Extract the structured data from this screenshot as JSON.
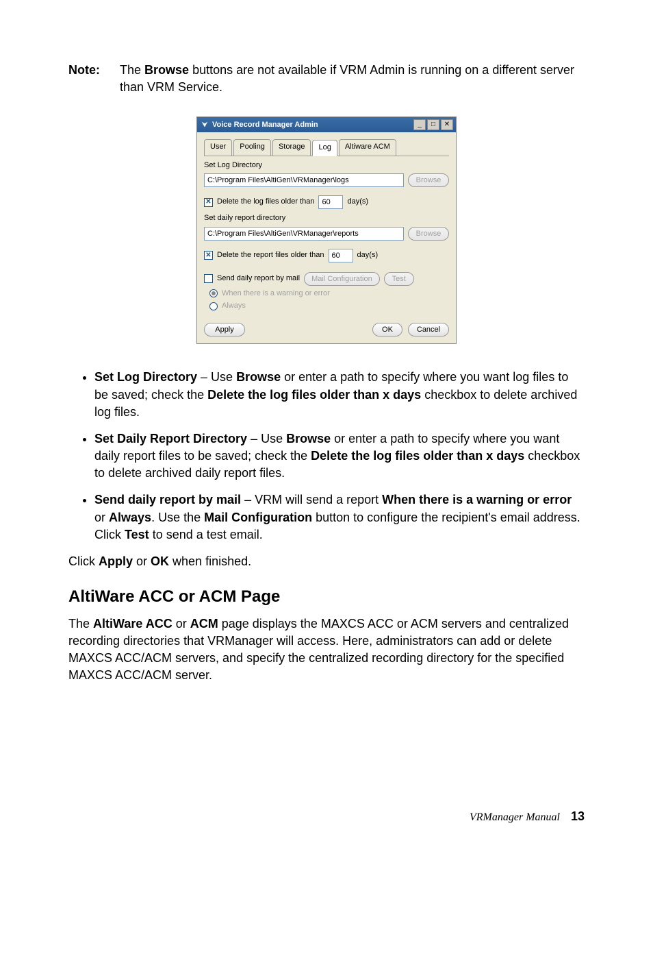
{
  "note": {
    "label": "Note:",
    "text_prefix": "The ",
    "text_bold": "Browse",
    "text_suffix": " buttons are not available if VRM Admin is running on a different server than VRM Service."
  },
  "dialog": {
    "title": "Voice Record Manager Admin",
    "tabs": {
      "user": "User",
      "pooling": "Pooling",
      "storage": "Storage",
      "log": "Log",
      "altiware": "Altiware ACM"
    },
    "set_log_dir_label": "Set Log Directory",
    "log_dir_value": "C:\\Program Files\\AltiGen\\VRManager\\logs",
    "browse1": "Browse",
    "delete_logs_label": "Delete the log files older than",
    "delete_logs_days": "60",
    "days_suffix": "day(s)",
    "set_report_dir_label": "Set daily report directory",
    "report_dir_value": "C:\\Program Files\\AltiGen\\VRManager\\reports",
    "browse2": "Browse",
    "delete_reports_label": "Delete the report files older than",
    "delete_reports_days": "60",
    "send_mail_label": "Send daily report by mail",
    "mail_config": "Mail Configuration",
    "test": "Test",
    "radio_warn": "When there is a warning or error",
    "radio_always": "Always",
    "apply": "Apply",
    "ok": "OK",
    "cancel": "Cancel"
  },
  "bullets": {
    "b1_bold1": "Set Log Directory",
    "b1_mid1": " – Use ",
    "b1_bold2": "Browse",
    "b1_mid2": " or enter a path to specify where you want log files to be saved; check the ",
    "b1_bold3": "Delete the log files older than x days",
    "b1_tail": " checkbox to delete archived log files.",
    "b2_bold1": "Set Daily Report Directory",
    "b2_mid1": " – Use ",
    "b2_bold2": "Browse",
    "b2_mid2": " or enter a path to specify where you want daily report files to be saved; check the ",
    "b2_bold3": "Delete the log files older than x days",
    "b2_tail": " checkbox to delete archived daily report files.",
    "b3_bold1": "Send daily report by mail",
    "b3_mid1": " – VRM will send a report ",
    "b3_bold2": "When there is a warning or error",
    "b3_mid2": " or ",
    "b3_bold3": "Always",
    "b3_mid3": ". Use the ",
    "b3_bold4": "Mail Configuration",
    "b3_mid4": " button to configure the recipient's email address. Click ",
    "b3_bold5": "Test",
    "b3_tail": " to send a test email."
  },
  "apply_ok": {
    "pre": "Click ",
    "b1": "Apply",
    "mid": " or ",
    "b2": "OK",
    "post": " when finished."
  },
  "section_heading": "AltiWare ACC or ACM Page",
  "section_para": {
    "pre": "The ",
    "b1": "AltiWare ACC",
    "mid1": " or ",
    "b2": "ACM",
    "tail": " page displays the MAXCS ACC or ACM servers and centralized recording directories that VRManager will access. Here, administrators can add or delete MAXCS ACC/ACM servers, and specify the centralized recording directory for the specified MAXCS ACC/ACM server."
  },
  "footer": {
    "title": "VRManager Manual",
    "page": "13"
  }
}
